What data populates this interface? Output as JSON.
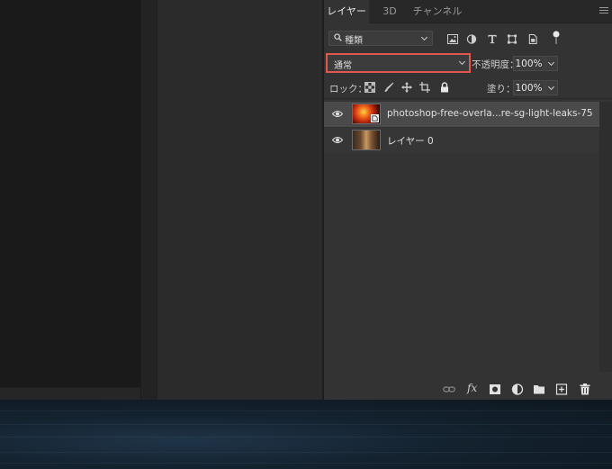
{
  "panel": {
    "tabs": [
      {
        "label": "レイヤー",
        "active": true
      },
      {
        "label": "3D",
        "active": false
      },
      {
        "label": "チャンネル",
        "active": false
      }
    ],
    "filter": {
      "label": "種類",
      "icons": [
        "image-filter-icon",
        "adjustment-filter-icon",
        "type-filter-icon",
        "shape-filter-icon",
        "smart-object-filter-icon",
        "filter-toggle-icon"
      ]
    },
    "blend_mode": {
      "value": "通常",
      "highlight_color": "#e2574c"
    },
    "opacity": {
      "label": "不透明度：",
      "value": "100%"
    },
    "lock": {
      "label": "ロック：",
      "icons": [
        "lock-transparent-pixels-icon",
        "lock-image-pixels-icon",
        "lock-position-icon",
        "lock-artboard-icon",
        "lock-all-icon"
      ]
    },
    "fill": {
      "label": "塗り：",
      "value": "100%"
    },
    "layers": [
      {
        "name": "photoshop-free-overla...re-sg-light-leaks-75",
        "visible": true,
        "selected": true,
        "smart_object": true
      },
      {
        "name": "レイヤー 0",
        "visible": true,
        "selected": false,
        "smart_object": false
      }
    ],
    "footer_icons": [
      "link-layers-icon",
      "fx-icon",
      "add-mask-icon",
      "adjustment-layer-icon",
      "new-group-icon",
      "new-layer-icon",
      "delete-icon"
    ],
    "footer_fx_label": "fx"
  },
  "colors": {
    "panel_bg": "#333333",
    "selected_layer_bg": "#4a4a4a",
    "highlight": "#e2574c"
  }
}
